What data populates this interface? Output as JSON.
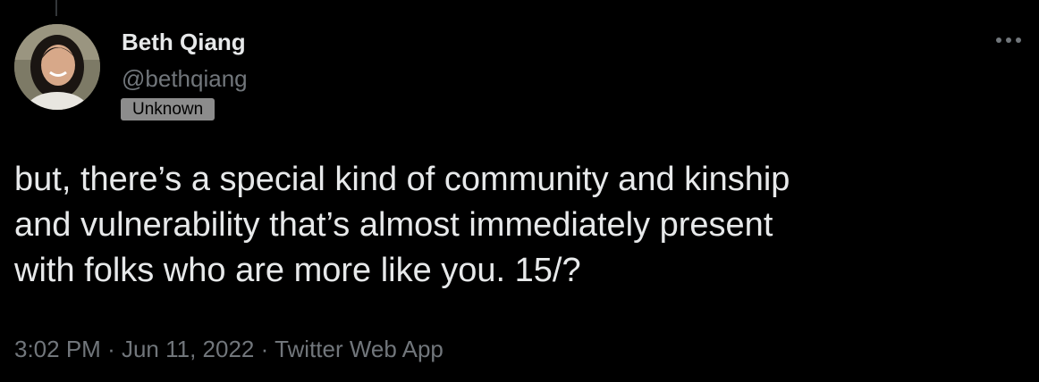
{
  "author": {
    "display_name": "Beth Qiang",
    "handle": "@bethqiang",
    "badge": "Unknown"
  },
  "tweet": {
    "lines": [
      "but, there’s a special kind of community and kinship",
      "and vulnerability that’s almost immediately present",
      "with folks who are more like you. 15/?"
    ]
  },
  "meta": {
    "time": "3:02 PM",
    "separator": "·",
    "date": "Jun 11, 2022",
    "source": "Twitter Web App"
  },
  "icons": {
    "more": "more-horizontal-icon"
  },
  "colors": {
    "background": "#000000",
    "primary_text": "#e7e9ea",
    "secondary_text": "#71767b"
  }
}
